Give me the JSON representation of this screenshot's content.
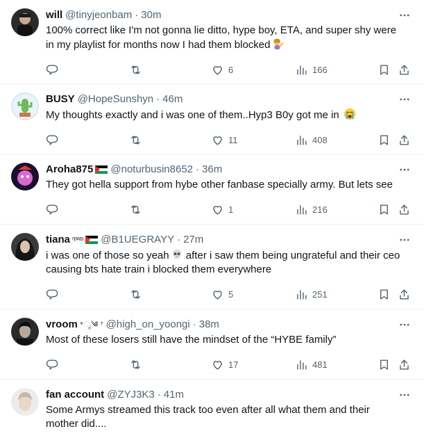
{
  "tweets": [
    {
      "name": "will",
      "name_suffix": "",
      "handle": "@tinyjeonbam",
      "time": "30m",
      "text": "100% correct like I'm not gonna lie ditto, hype boy, ETA, and super shy were in my playlist for months now I had them blocked",
      "emoji": "woman-tipping-hand",
      "likes": "6",
      "views": "166"
    },
    {
      "name": "BUSY",
      "name_suffix": "",
      "handle": "@HopeSunshyn",
      "time": "46m",
      "text": "My thoughts exactly and i was one of them..Hyp3 B0y got me in",
      "emoji": "loudly-crying-face",
      "likes": "11",
      "views": "408"
    },
    {
      "name": "Aroha875",
      "name_suffix": "",
      "handle": "@noturbusin8652",
      "time": "36m",
      "text": "They got hella support from hybe other fanbase specially army. But lets see",
      "emoji": "",
      "likes": "1",
      "views": "216"
    },
    {
      "name": "tiana",
      "name_suffix": "ʳᵖʷᵖ",
      "handle": "@B1UEGRAYY",
      "time": "27m",
      "text_a": "i was one of those so yeah",
      "text_b": "after i saw them being ungrateful and their ceo causing bts hate train i blocked them everywhere",
      "emoji": "skull",
      "likes": "5",
      "views": "251"
    },
    {
      "name": "vroom",
      "name_suffix": "*ೃ༄ ⁷",
      "handle": "@high_on_yoongi",
      "time": "38m",
      "text": "Most of these losers still have the mindset of the “HYBE family”",
      "emoji": "",
      "likes": "17",
      "views": "481"
    },
    {
      "name": "fan account",
      "name_suffix": "",
      "handle": "@ZYJ3K3",
      "time": "41m",
      "text": "Some Armys streamed this track too even after all what them and their mother did....",
      "emoji": ""
    }
  ],
  "separator": "·",
  "colors": {
    "text": "#0f1419",
    "secondary": "#536471",
    "border": "#eff3f4"
  }
}
